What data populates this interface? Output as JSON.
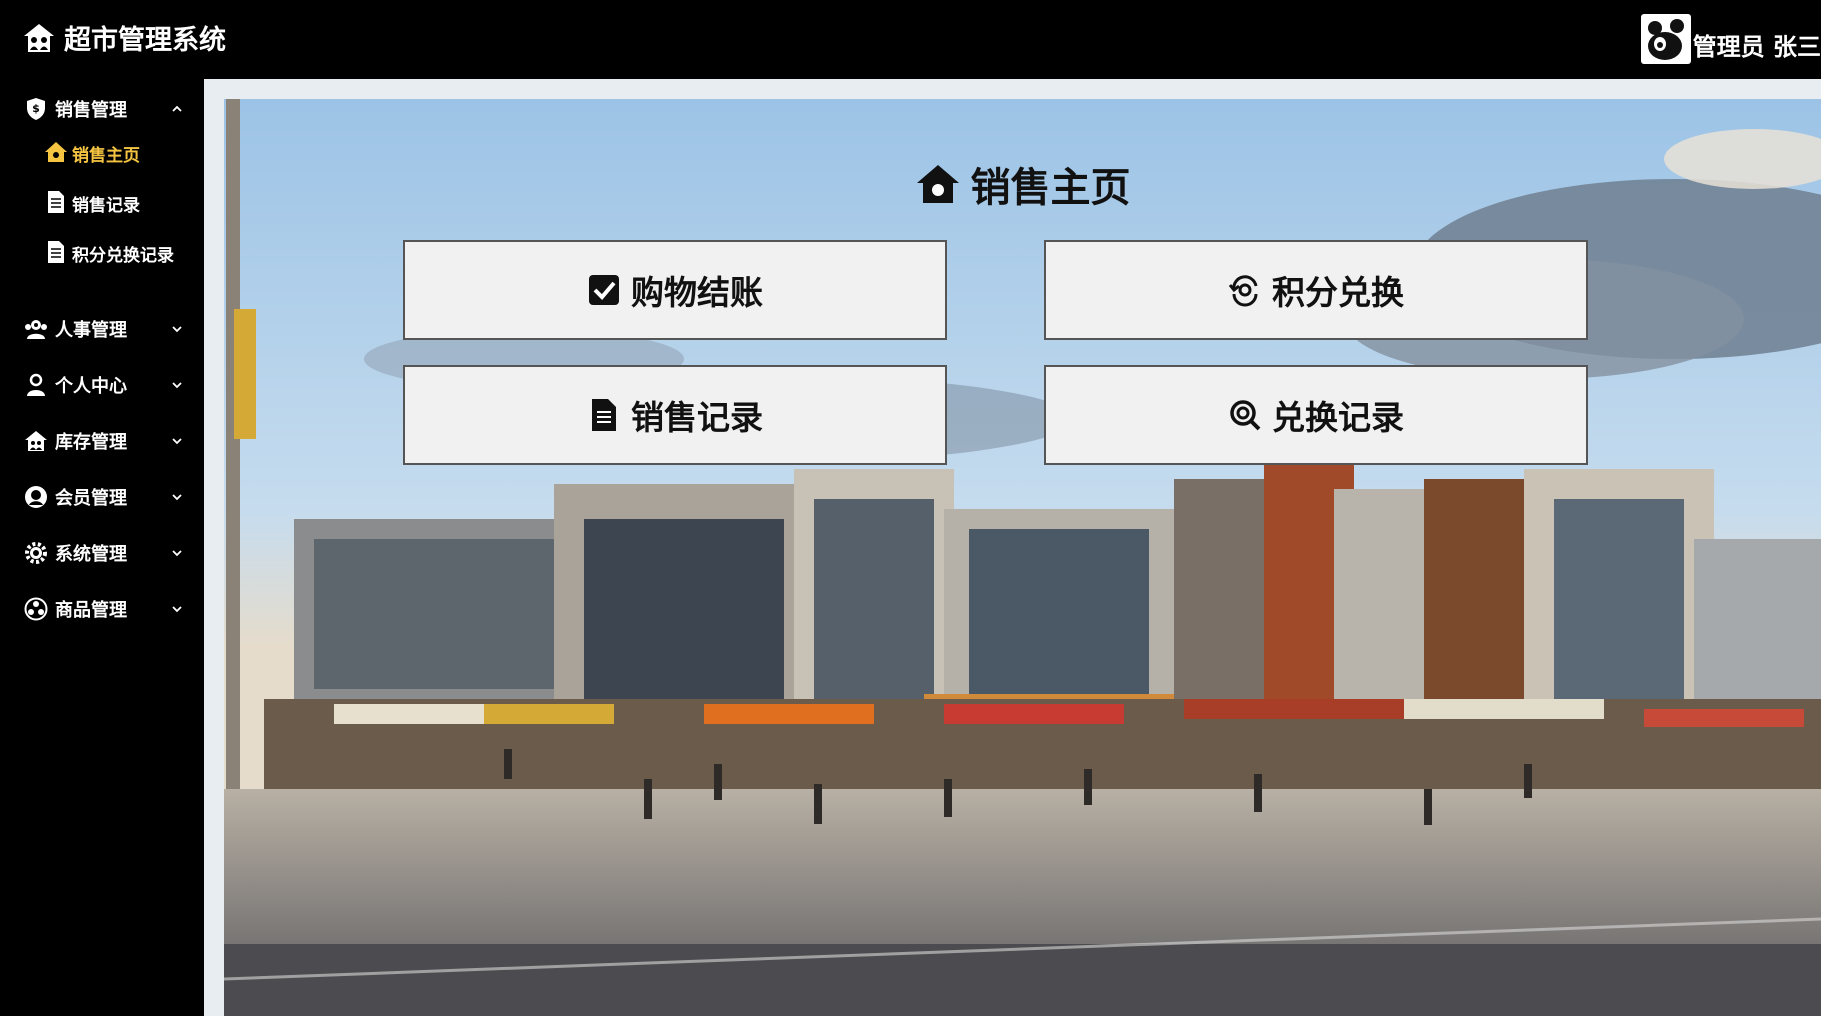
{
  "header": {
    "app_title": "超市管理系统",
    "app_icon": "house-people-icon",
    "user_label": "管理员 张三",
    "avatar_icon": "panda-avatar-icon"
  },
  "sidebar": {
    "groups": [
      {
        "label": "销售管理",
        "icon": "shield-icon",
        "expanded": true,
        "items": [
          {
            "label": "销售主页",
            "icon": "home-icon",
            "active": true
          },
          {
            "label": "销售记录",
            "icon": "document-icon",
            "active": false
          },
          {
            "label": "积分兑换记录",
            "icon": "document-icon",
            "active": false
          }
        ]
      },
      {
        "label": "人事管理",
        "icon": "team-icon",
        "expanded": false
      },
      {
        "label": "个人中心",
        "icon": "user-icon",
        "expanded": false
      },
      {
        "label": "库存管理",
        "icon": "warehouse-icon",
        "expanded": false
      },
      {
        "label": "会员管理",
        "icon": "member-icon",
        "expanded": false
      },
      {
        "label": "系统管理",
        "icon": "gear-icon",
        "expanded": false
      },
      {
        "label": "商品管理",
        "icon": "product-icon",
        "expanded": false
      }
    ],
    "active_color": "#f5c542"
  },
  "main": {
    "title": "销售主页",
    "title_icon": "home-icon",
    "actions": [
      {
        "label": "购物结账",
        "icon": "checkbox-icon"
      },
      {
        "label": "积分兑换",
        "icon": "exchange-icon"
      },
      {
        "label": "销售记录",
        "icon": "document-icon"
      },
      {
        "label": "兑换记录",
        "icon": "search-record-icon"
      }
    ]
  }
}
